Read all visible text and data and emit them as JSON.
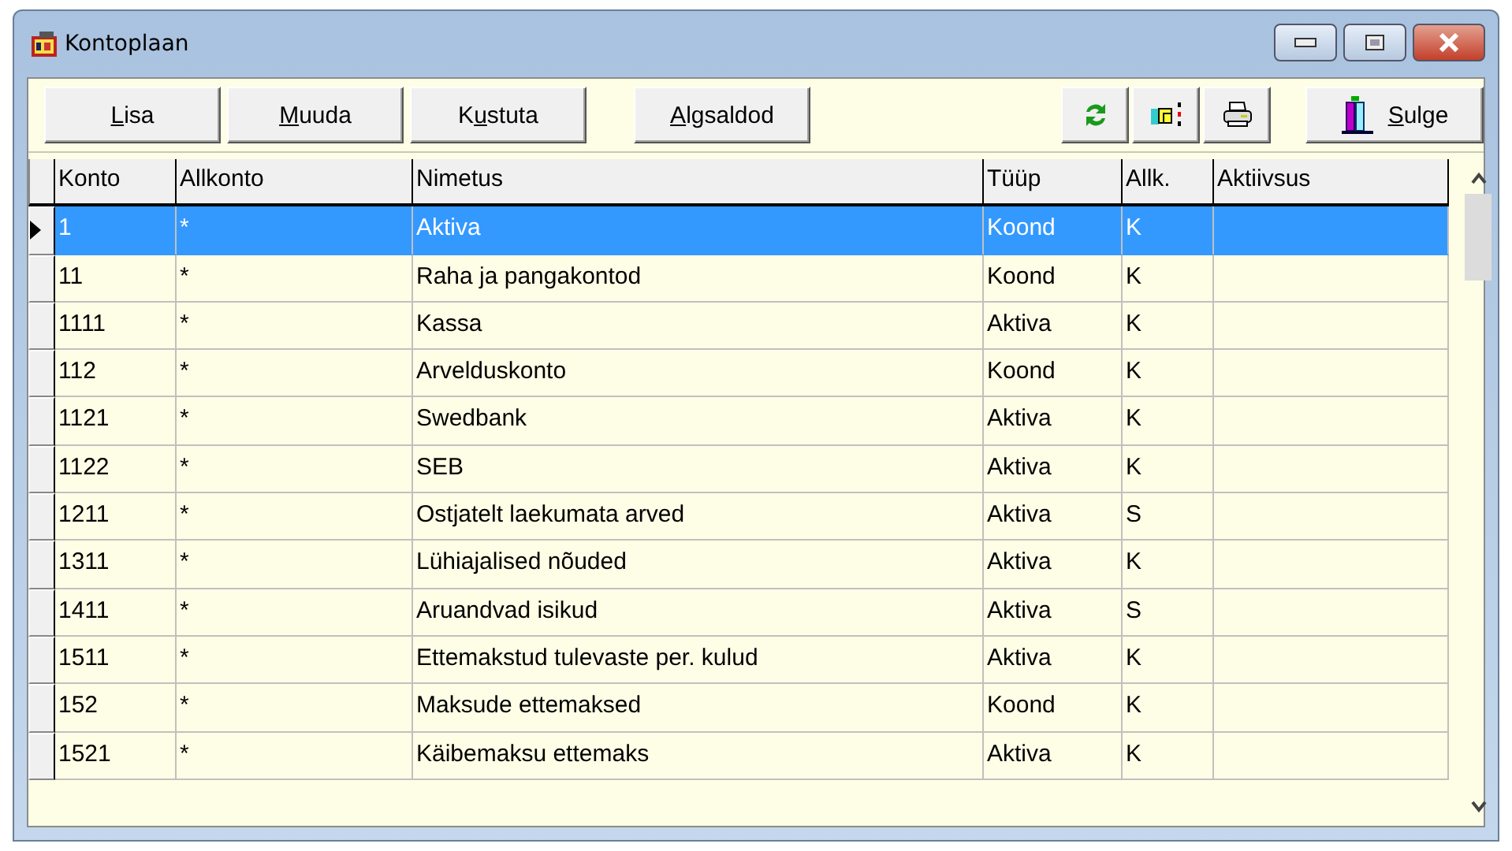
{
  "window": {
    "title": "Kontoplaan"
  },
  "toolbar": {
    "buttons": [
      {
        "kind": "text",
        "hotkey": "L",
        "label_post": "isa"
      },
      {
        "kind": "text",
        "hotkey": "M",
        "label_post": "uuda"
      },
      {
        "kind": "text",
        "label_pre": "K",
        "hotkey": "u",
        "label_post": "stuta"
      },
      {
        "kind": "text",
        "hotkey": "A",
        "label_post": "lgsaldod"
      },
      {
        "kind": "icon"
      },
      {
        "kind": "icon"
      },
      {
        "kind": "icon"
      },
      {
        "kind": "icon_text",
        "hotkey": "S",
        "label_post": "ulge"
      }
    ]
  },
  "table": {
    "columns": [
      "Konto",
      "Allkonto",
      "Nimetus",
      "Tüüp",
      "Allk.",
      "Aktiivsus"
    ],
    "rows": [
      {
        "selected": true,
        "cells": [
          "1",
          "*",
          "Aktiva",
          "Koond",
          "K",
          ""
        ]
      },
      {
        "selected": false,
        "cells": [
          "11",
          "*",
          "Raha ja pangakontod",
          "Koond",
          "K",
          ""
        ]
      },
      {
        "selected": false,
        "cells": [
          "1111",
          "*",
          "Kassa",
          "Aktiva",
          "K",
          ""
        ]
      },
      {
        "selected": false,
        "cells": [
          "112",
          "*",
          "Arvelduskonto",
          "Koond",
          "K",
          ""
        ]
      },
      {
        "selected": false,
        "cells": [
          "1121",
          "*",
          "Swedbank",
          "Aktiva",
          "K",
          ""
        ]
      },
      {
        "selected": false,
        "cells": [
          "1122",
          "*",
          "SEB",
          "Aktiva",
          "K",
          ""
        ]
      },
      {
        "selected": false,
        "cells": [
          "1211",
          "*",
          "Ostjatelt laekumata arved",
          "Aktiva",
          "S",
          ""
        ]
      },
      {
        "selected": false,
        "cells": [
          "1311",
          "*",
          "Lühiajalised nõuded",
          "Aktiva",
          "K",
          ""
        ]
      },
      {
        "selected": false,
        "cells": [
          "1411",
          "*",
          "Aruandvad isikud",
          "Aktiva",
          "S",
          ""
        ]
      },
      {
        "selected": false,
        "cells": [
          "1511",
          "*",
          "Ettemakstud tulevaste per. kulud",
          "Aktiva",
          "K",
          ""
        ]
      },
      {
        "selected": false,
        "cells": [
          "152",
          "*",
          "Maksude ettemaksed",
          "Koond",
          "K",
          ""
        ]
      },
      {
        "selected": false,
        "cells": [
          "1521",
          "*",
          "Käibemaksu ettemaks",
          "Aktiva",
          "K",
          ""
        ]
      }
    ]
  }
}
